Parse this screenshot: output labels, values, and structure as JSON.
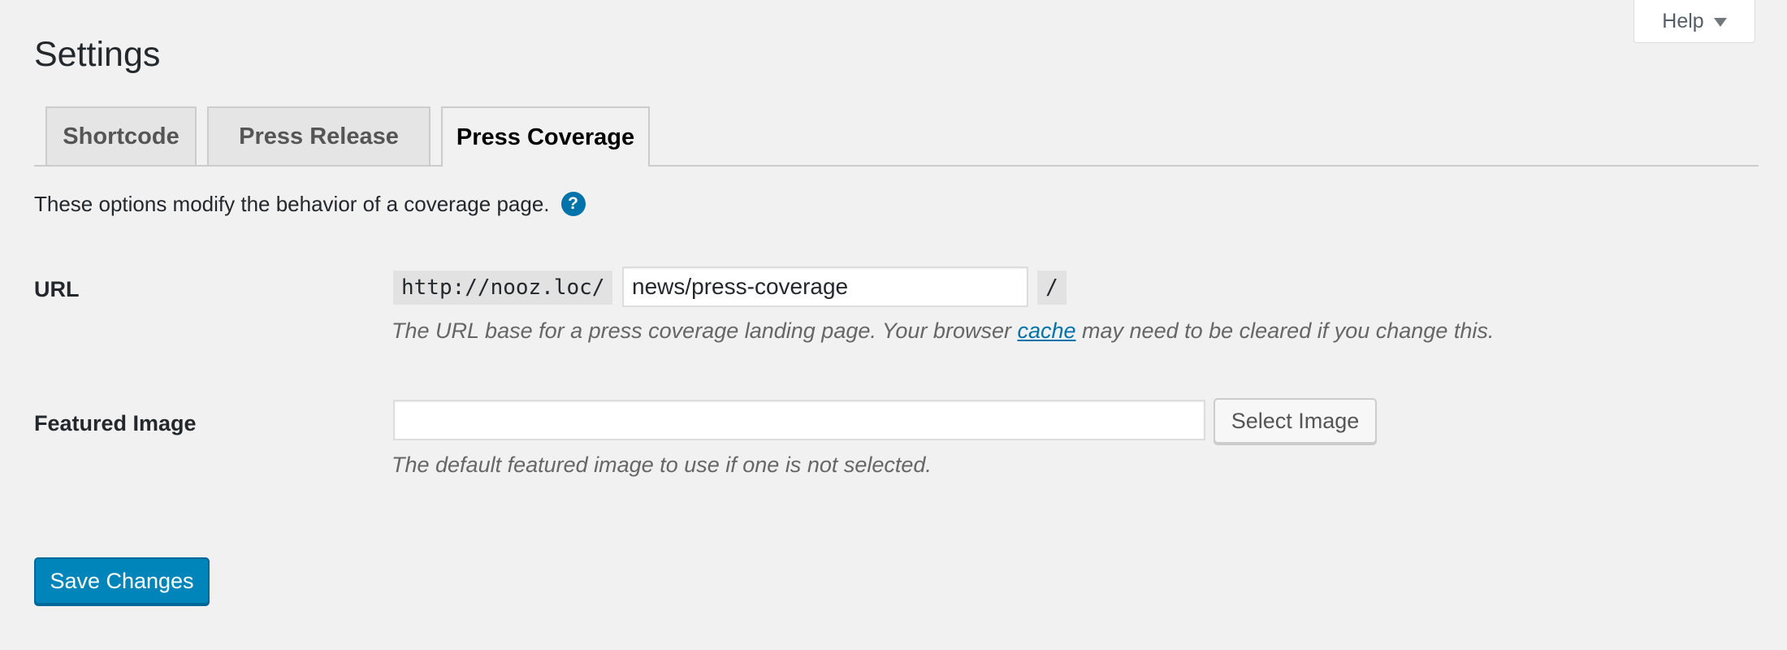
{
  "help": {
    "label": "Help"
  },
  "page": {
    "title": "Settings"
  },
  "tabs": [
    {
      "label": "Shortcode",
      "active": false
    },
    {
      "label": "Press Release",
      "active": false
    },
    {
      "label": "Press Coverage",
      "active": true
    }
  ],
  "intro": {
    "text": "These options modify the behavior of a coverage page.",
    "help_icon": "?"
  },
  "url_field": {
    "label": "URL",
    "base": "http://nooz.loc/",
    "value": "news/press-coverage",
    "suffix": "/",
    "desc_before": "The URL base for a press coverage landing page. Your browser ",
    "desc_link": "cache",
    "desc_after": " may need to be cleared if you change this."
  },
  "image_field": {
    "label": "Featured Image",
    "value": "",
    "button": "Select Image",
    "desc": "The default featured image to use if one is not selected."
  },
  "submit": {
    "label": "Save Changes"
  },
  "colors": {
    "primary": "#0085ba",
    "link": "#0073aa",
    "background": "#f1f1f1"
  }
}
